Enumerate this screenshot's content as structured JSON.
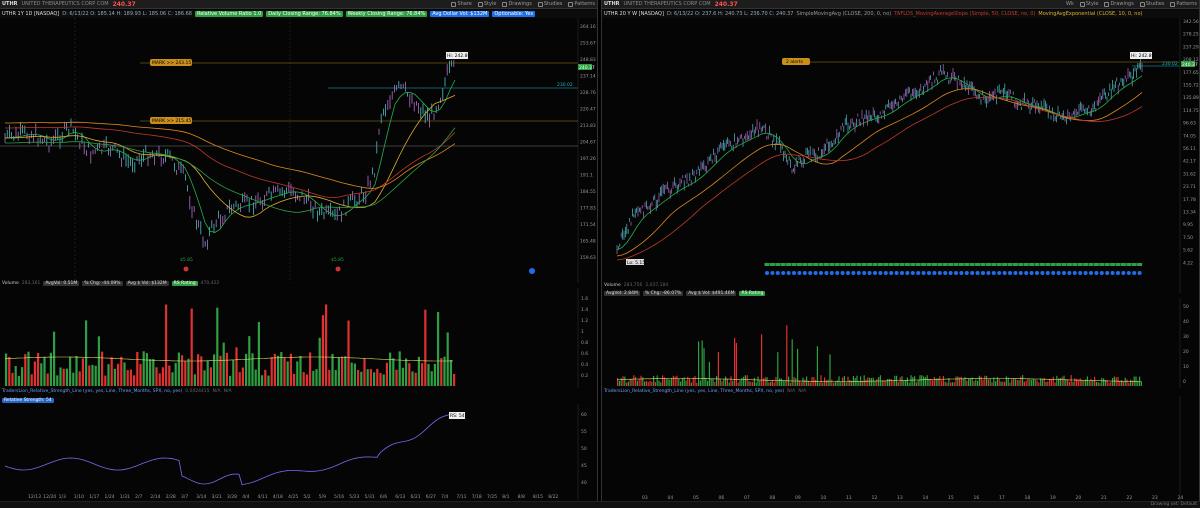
{
  "left": {
    "header": {
      "symbol": "UTHR",
      "description": "UNITED THERAPEUTICS CORP COM",
      "price": "240.37",
      "tools": [
        "Share",
        "Style",
        "Drawings",
        "Studies",
        "Patterns"
      ]
    },
    "infobar": {
      "timeframe": "UTHR 1Y 1D [NASDAQ]",
      "ohlc": "D: 6/13/22  O: 185.14  H: 189.93  L: 185.06  C: 186.68",
      "tags": [
        {
          "text": "Relative Volume Ratio 1.0",
          "color": "green"
        },
        {
          "text": "Daily Closing Range: 76.84%",
          "color": "green"
        },
        {
          "text": "Weekly Closing Range: 76.84%",
          "color": "green"
        },
        {
          "text": "Avg Dollar Vol: $132M",
          "color": "blue"
        },
        {
          "text": "Optionable: Yes",
          "color": "blue"
        }
      ]
    },
    "price_axis": [
      "264.16",
      "253.67",
      "248.83",
      "237.14",
      "228.76",
      "220.47",
      "213.83",
      "204.67",
      "197.26",
      "191.1",
      "184.55",
      "177.83",
      "171.54",
      "165.48",
      "159.63"
    ],
    "labels": {
      "hi": "Hi: 242.89",
      "mark1": "MARK >> 243.15",
      "mark2": "MARK >> 215.45",
      "level": "230.02",
      "price_tag": "240.37",
      "low1": "$5.85",
      "low2": "$5.85"
    },
    "volume": {
      "title": "Volume",
      "v1": "283,161",
      "avg": "AvgVol: 0.51M",
      "chg": "% Chg: -44.09%",
      "avgd": "Avg $ Vol: $132M",
      "lbl": "RS Rating",
      "v2": "470,422",
      "axis": [
        "1.6",
        "1.4",
        "1.2",
        "1",
        "0.8",
        "0.6",
        "0.4",
        "0.2"
      ]
    },
    "rs": {
      "title": "TradersLion_Relative_Strength_Line (yes, yes, Line, Three_Months, SPX, no, yes)",
      "vals": "0.0424415",
      "na1": "N/A",
      "na2": "N/A",
      "label": "Relative Strength: 54",
      "tag": "RS: 54",
      "axis": [
        "60",
        "55",
        "50",
        "45",
        "40"
      ]
    },
    "dates": [
      "12/13",
      "12/20",
      "1/3",
      "1/10",
      "1/17",
      "1/24",
      "1/31",
      "2/7",
      "2/14",
      "2/28",
      "3/7",
      "3/14",
      "3/21",
      "3/28",
      "4/4",
      "4/11",
      "4/18",
      "4/25",
      "5/2",
      "5/9",
      "5/16",
      "5/23",
      "5/31",
      "6/6",
      "6/13",
      "6/21",
      "6/27",
      "7/4",
      "7/11",
      "7/18",
      "7/25",
      "8/1",
      "8/8",
      "8/15",
      "8/22"
    ]
  },
  "right": {
    "header": {
      "symbol": "UTHR",
      "description": "UNITED THERAPEUTICS CORP COM",
      "price": "240.37",
      "tools": [
        "Wk",
        "Style",
        "Drawings",
        "Studies",
        "Patterns"
      ]
    },
    "infobar": {
      "timeframe": "UTHR 20 Y W [NASDAQ]",
      "ohlc": "D: 6/13/22  O: 237.6  H: 240.73  L: 236.70  C: 240.37",
      "tags": [
        {
          "text": "SimpleMovingAvg (CLOSE, 200, 0, no)",
          "color": "none"
        },
        {
          "text": "TAFLDS_MovingAverageSlope (Simple, 50, CLOSE, no, 0)",
          "color": "none"
        },
        {
          "text": "MovingAvgExponential (CLOSE, 10, 0, no)",
          "color": "none"
        }
      ]
    },
    "price_axis": [
      "342.56",
      "278.25",
      "237.29",
      "208.12",
      "177.65",
      "155.72",
      "135.89",
      "114.75",
      "96.63",
      "74.05",
      "56.11",
      "42.17",
      "31.62",
      "23.71",
      "17.78",
      "13.34",
      "9.95",
      "7.50",
      "5.62",
      "4.22"
    ],
    "labels": {
      "alert": "2 alerts",
      "hi": "Hi: 242.89",
      "level": "230.02",
      "price_tag": "240.37",
      "lo": "Lo: 5.15"
    },
    "volume": {
      "title": "Volume",
      "v1": "283,756",
      "avg": "AvgVol: 2.84M",
      "chg": "% Chg: -86.07%",
      "avgd": "Avg $ Vol: $491.46M",
      "lbl": "RS Rating",
      "v2": "2,037,184",
      "axis": [
        "50",
        "40",
        "30",
        "20",
        "10",
        "0"
      ]
    },
    "rs": {
      "title": "TradersLion_Relative_Strength_Line (yes, yes, Line, Three_Months, SPX, no, yes)",
      "na1": "N/A",
      "na2": "N/A"
    },
    "years": [
      "03",
      "04",
      "05",
      "06",
      "07",
      "08",
      "09",
      "10",
      "11",
      "12",
      "13",
      "14",
      "15",
      "16",
      "17",
      "18",
      "19",
      "20",
      "21",
      "22",
      "23",
      "24"
    ]
  },
  "footer": {
    "note": "Drawing set: Default"
  },
  "colors": {
    "bg": "#050505",
    "up": "#2ea043",
    "down": "#e03030",
    "ma_green": "#22b14c",
    "ma_orange": "#e08a1e",
    "ma_red": "#c0392b",
    "cyan": "#1fb5c7"
  }
}
